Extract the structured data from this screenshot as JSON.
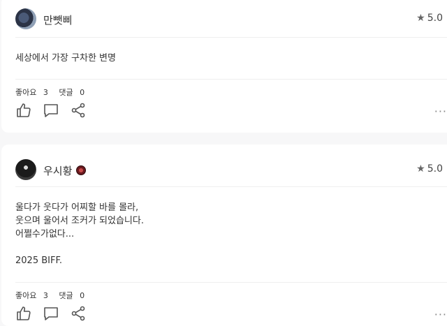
{
  "reviews": [
    {
      "username": "만뺏삐",
      "rating": "5.0",
      "content": "세상에서 가장 구차한 변명",
      "likes_label": "좋아요",
      "likes": "3",
      "comments_label": "댓글",
      "comments": "0",
      "has_badge": false
    },
    {
      "username": "우시황",
      "rating": "5.0",
      "content": "울다가 웃다가 어찌할 바를 몰라,\n웃으며 울어서 조커가 되었습니다.\n어쩔수가없다...\n\n2025 BIFF.",
      "likes_label": "좋아요",
      "likes": "3",
      "comments_label": "댓글",
      "comments": "0",
      "has_badge": true
    }
  ],
  "icons": {
    "like": "thumbs-up-icon",
    "comment": "speech-bubble-icon",
    "share": "share-icon",
    "more": "more-horizontal-icon",
    "star": "star-icon"
  },
  "more_glyph": "···",
  "star_glyph": "★"
}
